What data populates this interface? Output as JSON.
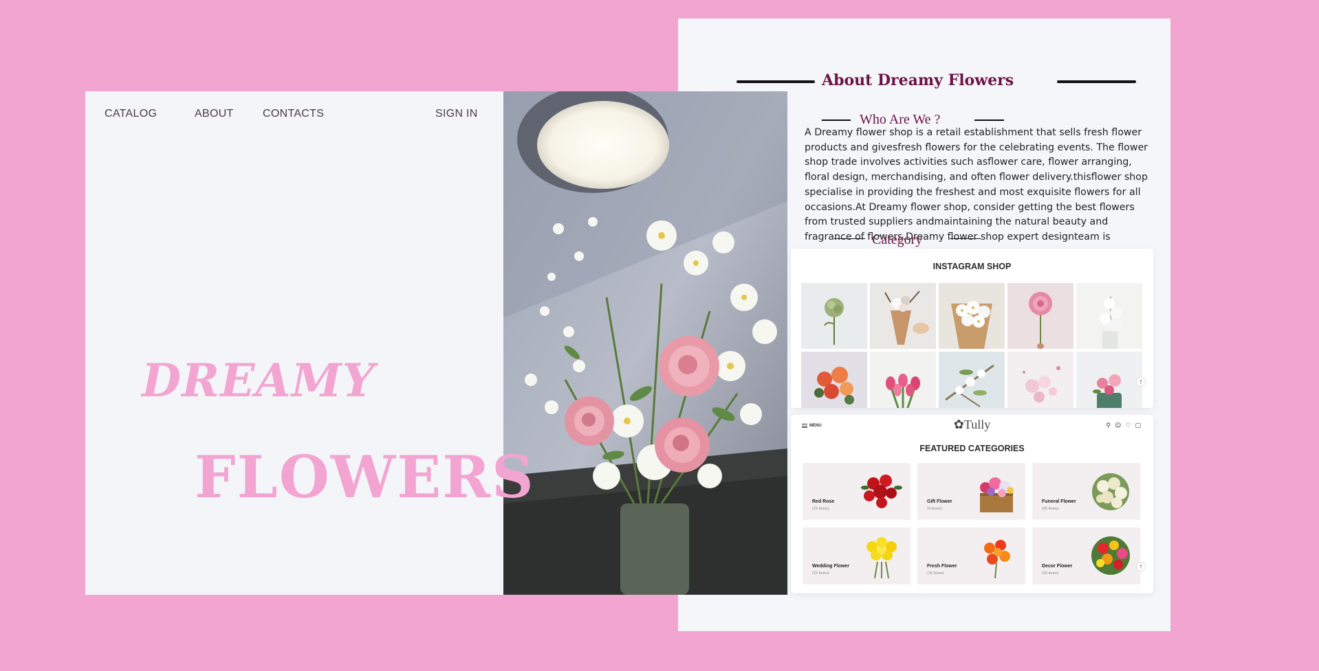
{
  "nav": {
    "catalog": "CATALOG",
    "about": "ABOUT",
    "contacts": "CONTACTS",
    "sign_in": "SIGN IN"
  },
  "hero": {
    "line1": "DREAMY",
    "line2": "FLOWERS"
  },
  "about": {
    "title": "About Dreamy Flowers",
    "subtitle": "Who Are We ?",
    "body": "A Dreamy flower shop is a retail establishment that sells fresh flower products and givesfresh flowers for the celebrating events. The flower shop trade involves activities such asflower care, flower arranging, floral design, merchandising, and often flower delivery.thisflower shop specialise in providing the freshest and most exquisite flowers for all occasions.At Dreamy flower shop, consider getting the best flowers from trusted suppliers andmaintaining the natural beauty and fragrance of flowers.Dreamy flower shop expert designteam is",
    "category_label": "Category"
  },
  "instagram": {
    "title": "INSTAGRAM SHOP"
  },
  "tully": {
    "menu_label": "MENU",
    "logo": "Tully",
    "featured_title": "FEATURED CATEGORIES",
    "categories": [
      {
        "name": "Red Rose",
        "count": "(22 Items)"
      },
      {
        "name": "Gift Flower",
        "count": "(9 Items)"
      },
      {
        "name": "Funeral Flower",
        "count": "(35 Items)"
      },
      {
        "name": "Wedding Flower",
        "count": "(23 Items)"
      },
      {
        "name": "Fresh Flower",
        "count": "(16 Items)"
      },
      {
        "name": "Decor Flower",
        "count": "(20 Items)"
      }
    ]
  },
  "icons": {
    "search": "search-icon",
    "user": "user-icon",
    "wishlist": "heart-icon",
    "cart": "cart-icon",
    "scroll_up": "arrow-up-icon"
  },
  "colors": {
    "background": "#f3a5d2",
    "panel": "#f4f5f9",
    "heading": "#6b1446",
    "hero_text": "#f3a5d2"
  }
}
